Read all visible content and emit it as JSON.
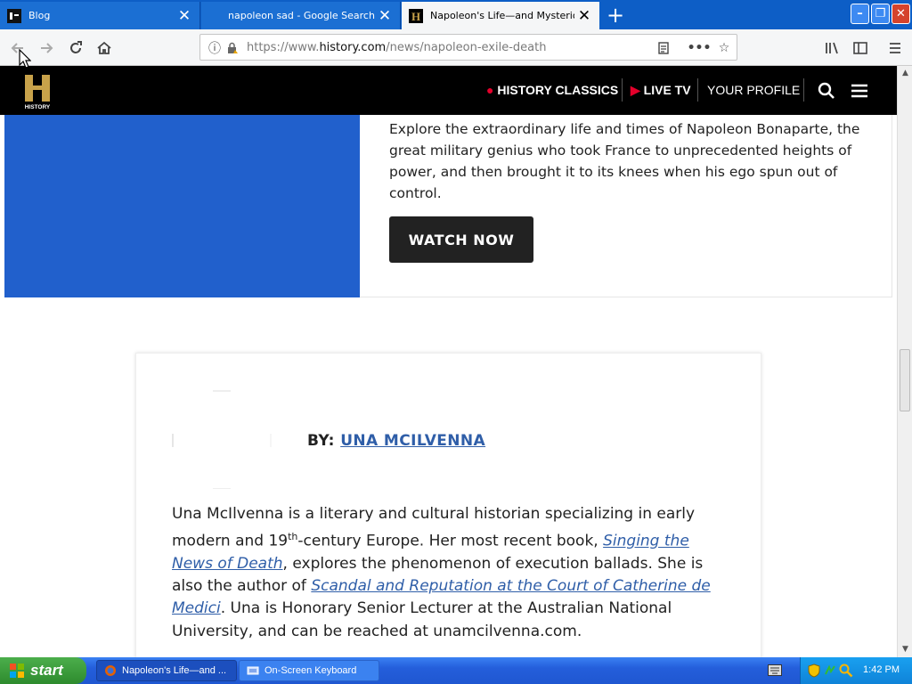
{
  "browser": {
    "tabs": [
      {
        "title": "Blog",
        "close": "✕"
      },
      {
        "title": "napoleon sad - Google Search",
        "close": "✕"
      },
      {
        "title": "Napoleon's Life—and Mysterious D",
        "close": "✕"
      }
    ],
    "new_tab": "+",
    "window_buttons": {
      "minimize": "–",
      "maximize": "❐",
      "close": "✕"
    },
    "url_prefix": "https://www.",
    "url_domain": "history.com",
    "url_path": "/news/napoleon-exile-death"
  },
  "site": {
    "nav": {
      "classics": "HISTORY CLASSICS",
      "live_tv": "LIVE TV",
      "profile": "YOUR PROFILE"
    },
    "promo": {
      "text": "Explore the extraordinary life and times of Napoleon Bonaparte, the great military genius who took France to unprecedented heights of power, and then brought it to its knees when his ego spun out of control.",
      "button": "WATCH NOW"
    },
    "author": {
      "by_label": "BY:",
      "name": "UNA MCILVENNA",
      "bio_1": "Una McIlvenna is a literary and cultural historian specializing in early modern and 19",
      "bio_sup": "th",
      "bio_2": "-century Europe. Her most recent book, ",
      "book_1": "Singing the News of Death",
      "bio_3": ", explores the phenomenon of execution ballads. She is also the author of ",
      "book_2": "Scandal and Reputation at the Court of Catherine de Medici",
      "bio_4": ". Una is Honorary Senior Lecturer at the Australian National University, and can be reached at unamcilvenna.com."
    },
    "colors": {
      "accent_blue": "#2160cc",
      "link": "#2f5ea8",
      "live_red": "#e4002b"
    }
  },
  "taskbar": {
    "start": "start",
    "buttons": [
      "Napoleon's Life—and ...",
      "On-Screen Keyboard"
    ],
    "clock": "1:42 PM"
  }
}
